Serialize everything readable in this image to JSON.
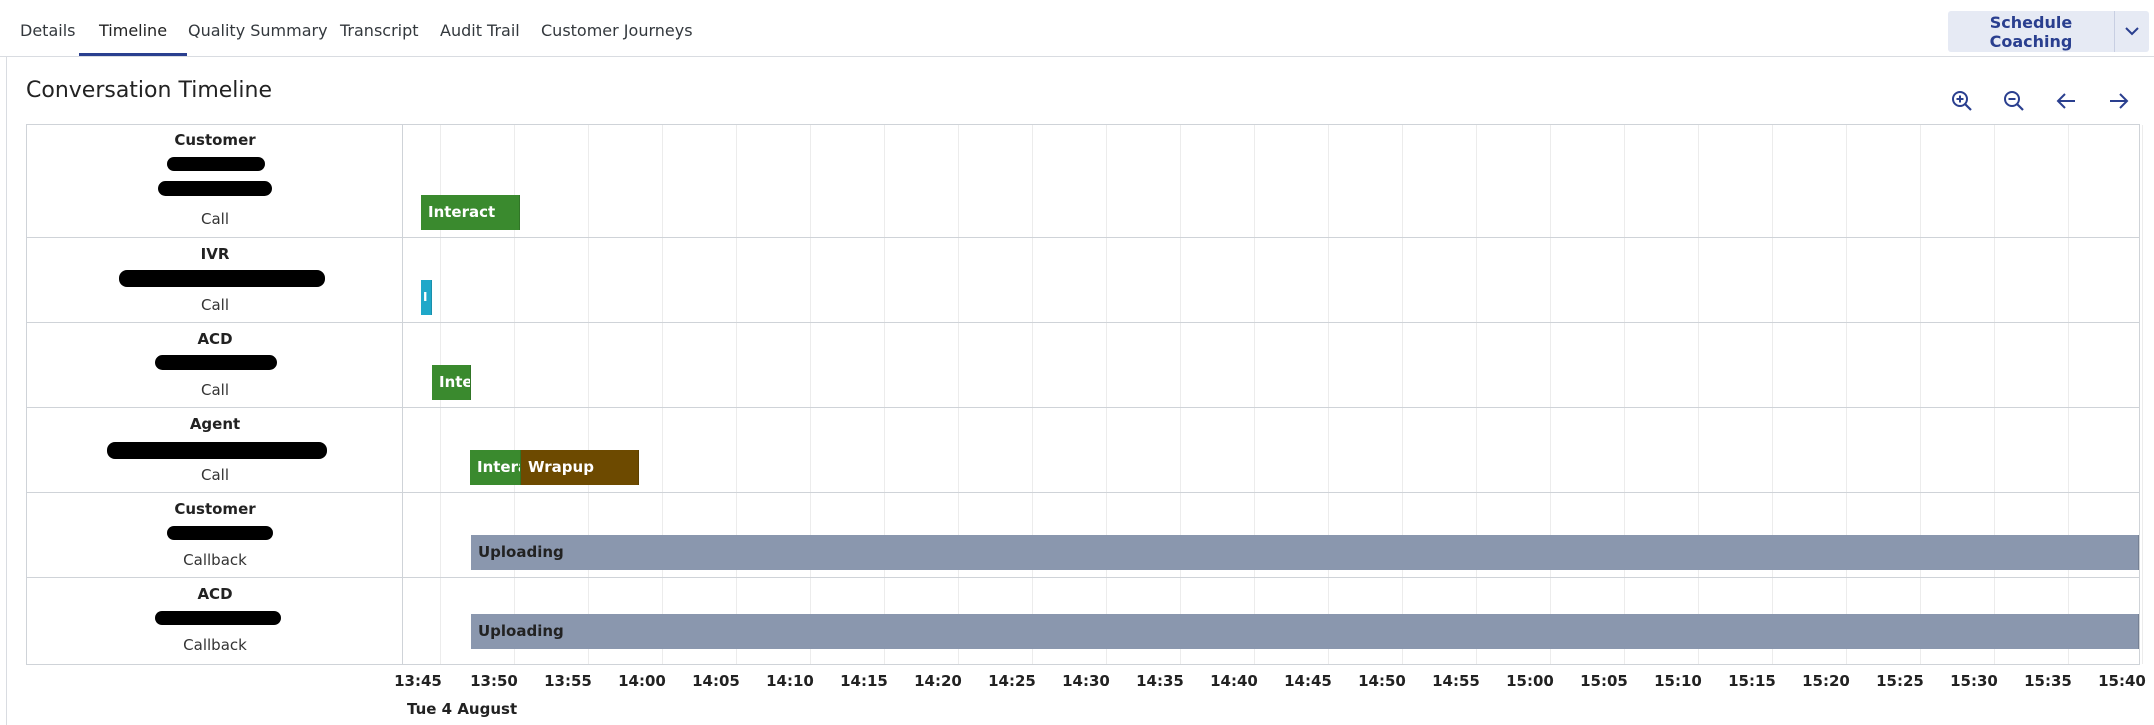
{
  "tabs": [
    {
      "label": "Details"
    },
    {
      "label": "Timeline"
    },
    {
      "label": "Quality Summary"
    },
    {
      "label": "Transcript"
    },
    {
      "label": "Audit Trail"
    },
    {
      "label": "Customer Journeys"
    }
  ],
  "actions": {
    "schedule_coaching": "Schedule Coaching"
  },
  "timeline": {
    "title": "Conversation Timeline",
    "date": "Tue 4 August",
    "ticks": [
      "13:45",
      "13:50",
      "13:55",
      "14:00",
      "14:05",
      "14:10",
      "14:15",
      "14:20",
      "14:25",
      "14:30",
      "14:35",
      "14:40",
      "14:45",
      "14:50",
      "14:55",
      "15:00",
      "15:05",
      "15:10",
      "15:15",
      "15:20",
      "15:25",
      "15:30",
      "15:35",
      "15:40"
    ],
    "rows": [
      {
        "role": "Customer",
        "media": "Call"
      },
      {
        "role": "IVR",
        "media": "Call"
      },
      {
        "role": "ACD",
        "media": "Call"
      },
      {
        "role": "Agent",
        "media": "Call"
      },
      {
        "role": "Customer",
        "media": "Callback"
      },
      {
        "role": "ACD",
        "media": "Callback"
      }
    ],
    "segments": {
      "customer_call_interact": "Interact",
      "ivr_call": "I",
      "acd_call_interact": "Interact",
      "agent_call_interact": "Interact",
      "agent_call_wrapup": "Wrapup",
      "customer_callback_uploading": "Uploading",
      "acd_callback_uploading": "Uploading"
    }
  },
  "colors": {
    "accent": "#2a3f8f",
    "interact": "#3a8a2e",
    "ivr": "#1fa8c9",
    "wrapup": "#6d4a00",
    "uploading": "#8a97ae"
  },
  "icons": [
    "zoom-in-icon",
    "zoom-out-icon",
    "arrow-left-icon",
    "arrow-right-icon",
    "chevron-down-icon"
  ]
}
